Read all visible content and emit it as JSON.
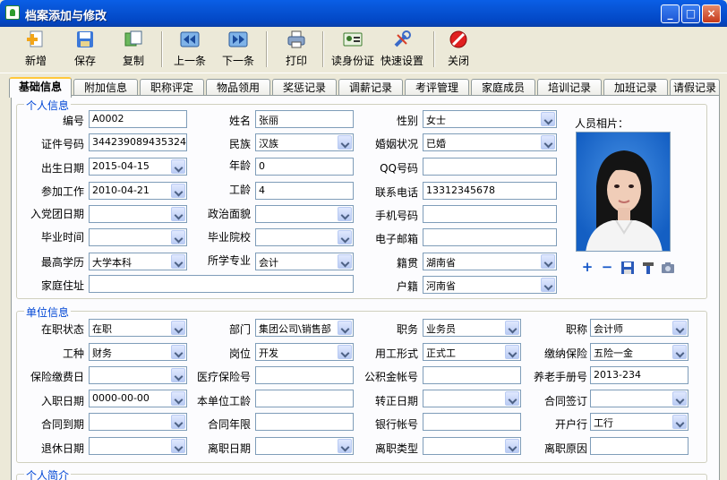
{
  "window": {
    "title": "档案添加与修改"
  },
  "toolbar": {
    "add": "新增",
    "save": "保存",
    "copy": "复制",
    "prev": "上一条",
    "next": "下一条",
    "print": "打印",
    "read_id": "读身份证",
    "quick_set": "快速设置",
    "close": "关闭"
  },
  "tabs": [
    "基础信息",
    "附加信息",
    "职称评定",
    "物品领用",
    "奖惩记录",
    "调薪记录",
    "考评管理",
    "家庭成员",
    "培训记录",
    "加班记录",
    "请假记录"
  ],
  "personal": {
    "section_title": "个人信息",
    "photo_label": "人员相片：",
    "f": {
      "bianhao": {
        "label": "编号",
        "value": "A0002"
      },
      "xingming": {
        "label": "姓名",
        "value": "张丽"
      },
      "xingbie": {
        "label": "性别",
        "value": "女士"
      },
      "zhengjian": {
        "label": "证件号码",
        "value": "344239089435324"
      },
      "minzu": {
        "label": "民族",
        "value": "汉族"
      },
      "hunyin": {
        "label": "婚姻状况",
        "value": "已婚"
      },
      "chusheng": {
        "label": "出生日期",
        "value": "2015-04-15"
      },
      "nianling": {
        "label": "年龄",
        "value": "0"
      },
      "qq": {
        "label": "QQ号码",
        "value": ""
      },
      "canjia": {
        "label": "参加工作",
        "value": "2010-04-21"
      },
      "gongling": {
        "label": "工龄",
        "value": "4"
      },
      "dianhua": {
        "label": "联系电话",
        "value": "13312345678"
      },
      "rudang": {
        "label": "入党团日期",
        "value": ""
      },
      "zhengzhi": {
        "label": "政治面貌",
        "value": ""
      },
      "shouji": {
        "label": "手机号码",
        "value": ""
      },
      "biye_shijian": {
        "label": "毕业时间",
        "value": ""
      },
      "biye_yuanxiao": {
        "label": "毕业院校",
        "value": ""
      },
      "youxiang": {
        "label": "电子邮箱",
        "value": ""
      },
      "xueli": {
        "label": "最高学历",
        "value": "大学本科"
      },
      "zhuanye": {
        "label": "所学专业",
        "value": "会计"
      },
      "jiguan": {
        "label": "籍贯",
        "value": "湖南省"
      },
      "zhuzhi": {
        "label": "家庭住址",
        "value": ""
      },
      "huji": {
        "label": "户籍",
        "value": "河南省"
      }
    }
  },
  "unit": {
    "section_title": "单位信息",
    "f": {
      "zaizhi": {
        "label": "在职状态",
        "value": "在职"
      },
      "bumen": {
        "label": "部门",
        "value": "集团公司\\销售部"
      },
      "zhiwu": {
        "label": "职务",
        "value": "业务员"
      },
      "zhicheng": {
        "label": "职称",
        "value": "会计师"
      },
      "gongzhong": {
        "label": "工种",
        "value": "财务"
      },
      "gangwei": {
        "label": "岗位",
        "value": "开发"
      },
      "yonggong": {
        "label": "用工形式",
        "value": "正式工"
      },
      "jiaona": {
        "label": "缴纳保险",
        "value": "五险一金"
      },
      "baoxian_ri": {
        "label": "保险缴费日",
        "value": ""
      },
      "yiliao": {
        "label": "医疗保险号",
        "value": ""
      },
      "gongjijin": {
        "label": "公积金帐号",
        "value": ""
      },
      "yanglao": {
        "label": "养老手册号",
        "value": "2013-234"
      },
      "ruzhi": {
        "label": "入职日期",
        "value": "0000-00-00"
      },
      "benwei": {
        "label": "本单位工龄",
        "value": ""
      },
      "zhuanzheng": {
        "label": "转正日期",
        "value": ""
      },
      "hetong_qian": {
        "label": "合同签订",
        "value": ""
      },
      "hetong_dao": {
        "label": "合同到期",
        "value": ""
      },
      "hetong_nian": {
        "label": "合同年限",
        "value": ""
      },
      "yinhang": {
        "label": "银行帐号",
        "value": ""
      },
      "kaihu": {
        "label": "开户行",
        "value": "工行"
      },
      "tuixiu": {
        "label": "退休日期",
        "value": ""
      },
      "lizhi_ri": {
        "label": "离职日期",
        "value": ""
      },
      "lizhi_lei": {
        "label": "离职类型",
        "value": ""
      },
      "lizhi_yuan": {
        "label": "离职原因",
        "value": ""
      }
    }
  },
  "intro": {
    "section_title": "个人简介"
  },
  "colors": {
    "title_bar": "#0A5FE6",
    "group_title": "#0046D5",
    "tab_highlight": "#FFC83C",
    "window_bg": "#ECE9D8"
  }
}
